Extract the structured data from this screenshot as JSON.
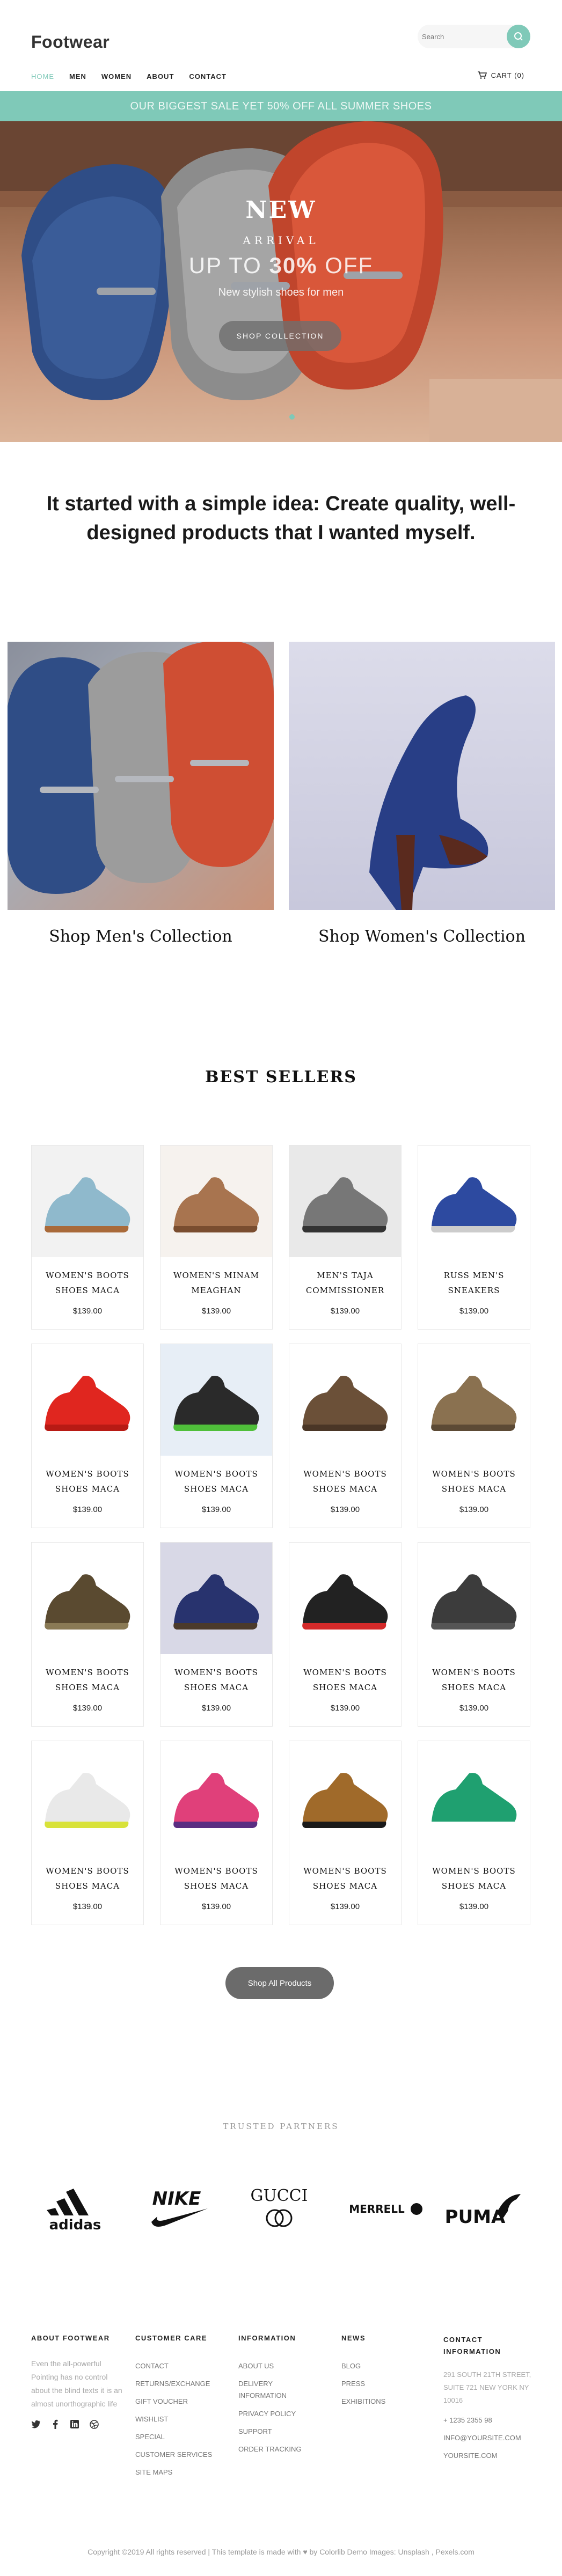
{
  "header": {
    "logo": "Footwear",
    "search_placeholder": "Search",
    "nav": [
      "HOME",
      "MEN",
      "WOMEN",
      "ABOUT",
      "CONTACT"
    ],
    "cart": "CART (0)"
  },
  "promo": "OUR BIGGEST SALE YET 50% OFF ALL SUMMER SHOES",
  "hero": {
    "title": "NEW",
    "subtitle": "ARRIVAL",
    "offer_prefix": "UP TO ",
    "offer_value": "30%",
    "offer_suffix": " OFF",
    "tagline": "New stylish shoes for men",
    "button": "SHOP COLLECTION"
  },
  "intro": "It started with a simple idea: Create quality, well-designed products that I wanted myself.",
  "collections": {
    "men": "Shop Men's Collection",
    "women": "Shop Women's Collection"
  },
  "best_sellers": {
    "title": "BEST SELLERS",
    "products": [
      {
        "name": "WOMEN'S BOOTS SHOES MACA",
        "price": "$139.00"
      },
      {
        "name": "WOMEN'S MINAM MEAGHAN",
        "price": "$139.00"
      },
      {
        "name": "MEN'S TAJA COMMISSIONER",
        "price": "$139.00"
      },
      {
        "name": "RUSS MEN'S SNEAKERS",
        "price": "$139.00"
      },
      {
        "name": "WOMEN'S BOOTS SHOES MACA",
        "price": "$139.00"
      },
      {
        "name": "WOMEN'S BOOTS SHOES MACA",
        "price": "$139.00"
      },
      {
        "name": "WOMEN'S BOOTS SHOES MACA",
        "price": "$139.00"
      },
      {
        "name": "WOMEN'S BOOTS SHOES MACA",
        "price": "$139.00"
      },
      {
        "name": "WOMEN'S BOOTS SHOES MACA",
        "price": "$139.00"
      },
      {
        "name": "WOMEN'S BOOTS SHOES MACA",
        "price": "$139.00"
      },
      {
        "name": "WOMEN'S BOOTS SHOES MACA",
        "price": "$139.00"
      },
      {
        "name": "WOMEN'S BOOTS SHOES MACA",
        "price": "$139.00"
      },
      {
        "name": "WOMEN'S BOOTS SHOES MACA",
        "price": "$139.00"
      },
      {
        "name": "WOMEN'S BOOTS SHOES MACA",
        "price": "$139.00"
      },
      {
        "name": "WOMEN'S BOOTS SHOES MACA",
        "price": "$139.00"
      },
      {
        "name": "WOMEN'S BOOTS SHOES MACA",
        "price": "$139.00"
      }
    ],
    "button": "Shop All Products"
  },
  "partners": {
    "title": "TRUSTED PARTNERS",
    "brands": [
      "adidas",
      "NIKE",
      "GUCCI",
      "MERRELL",
      "PUMA"
    ]
  },
  "footer": {
    "about": {
      "title": "ABOUT FOOTWEAR",
      "text": "Even the all-powerful Pointing has no control about the blind texts it is an almost unorthographic life"
    },
    "care": {
      "title": "CUSTOMER CARE",
      "links": [
        "CONTACT",
        "RETURNS/EXCHANGE",
        "GIFT VOUCHER",
        "WISHLIST",
        "SPECIAL",
        "CUSTOMER SERVICES",
        "SITE MAPS"
      ]
    },
    "info": {
      "title": "INFORMATION",
      "links": [
        "ABOUT US",
        "DELIVERY INFORMATION",
        "PRIVACY POLICY",
        "SUPPORT",
        "ORDER TRACKING"
      ]
    },
    "news": {
      "title": "NEWS",
      "links": [
        "BLOG",
        "PRESS",
        "EXHIBITIONS"
      ]
    },
    "contact": {
      "title": "CONTACT INFORMATION",
      "address": "291 SOUTH 21TH STREET, SUITE 721 NEW YORK NY 10016",
      "phone": "+ 1235 2355 98",
      "email": "INFO@YOURSITE.COM",
      "site": "YOURSITE.COM"
    },
    "copyright": "Copyright ©2019 All rights reserved | This template is made with ♥ by Colorlib Demo Images: Unsplash , Pexels.com"
  }
}
